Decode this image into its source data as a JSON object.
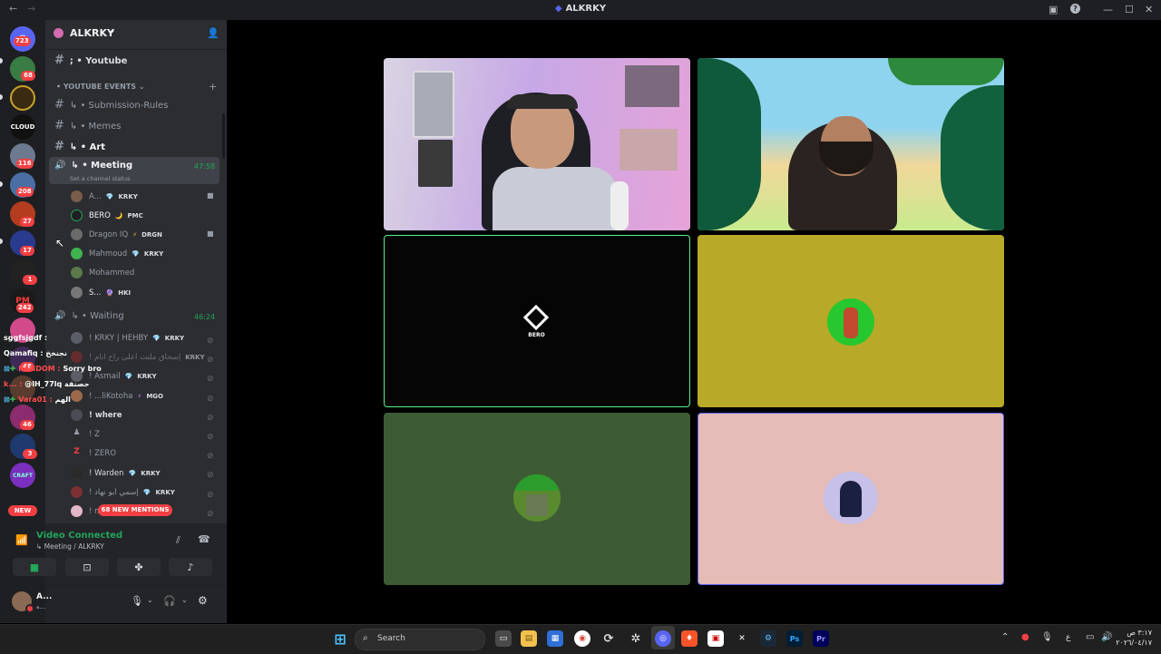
{
  "window": {
    "title": "ALKRKY"
  },
  "server": {
    "name": "ALKRKY"
  },
  "rail_badges": [
    "723",
    "68",
    "116",
    "208",
    "27",
    "17",
    "1",
    "242",
    "48",
    "46",
    "3"
  ],
  "rail_new_label": "NEW",
  "channels": {
    "youtube": "; • Youtube",
    "category": "• YOUTUBE EVENTS",
    "submission": "↳ • Submission-Rules",
    "memes": "↳ • Memes",
    "art": "↳ • Art",
    "meeting": "↳ • Meeting",
    "meeting_time": "47:58",
    "meeting_status": "Set a channel status",
    "waiting": "↳ • Waiting",
    "waiting_time": "46:24"
  },
  "meeting_members": [
    {
      "name": "A...",
      "tag": "KRKY"
    },
    {
      "name": "BERO",
      "tag": "PMC"
    },
    {
      "name": "Dragon IQ",
      "tag": "DRGN"
    },
    {
      "name": "Mahmoud",
      "tag": "KRKY"
    },
    {
      "name": "Mohammed",
      "tag": ""
    },
    {
      "name": "S...",
      "tag": "HKI"
    }
  ],
  "waiting_members": [
    {
      "name": "! KRKY | HEHBY",
      "tag": "KRKY"
    },
    {
      "name": "! إسحاق ملتت اعلى راح انام",
      "tag": "KRKY"
    },
    {
      "name": "! Asmail",
      "tag": "KRKY"
    },
    {
      "name": "! ...liKotoha",
      "tag": "MGO"
    },
    {
      "name": "! where",
      "tag": ""
    },
    {
      "name": "! Z",
      "tag": ""
    },
    {
      "name": "! ZERO",
      "tag": ""
    },
    {
      "name": "! Warden",
      "tag": "KRKY"
    },
    {
      "name": "! إسمي ابو نهاد",
      "tag": "KRKY"
    },
    {
      "name": "! m",
      "tag": ""
    }
  ],
  "mentions_label": "68 NEW MENTIONS",
  "chat_overlay": [
    {
      "user": "sggfsjgdf :",
      "msg": "",
      "color": "#ffffff"
    },
    {
      "user": "Qamafiq :",
      "msg": "نجنخخ",
      "color": "#ffffff"
    },
    {
      "user": "RANDOM :",
      "msg": "Sorry bro",
      "color": "#ff4d4d"
    },
    {
      "user": "k... :",
      "msg": "@lH_77lq حصنقة",
      "color": "#ff4d4d"
    },
    {
      "user": "Vara01 :",
      "msg": "الهم",
      "color": "#ff4d4d"
    }
  ],
  "voice": {
    "status": "Video Connected",
    "location": "↳ Meeting / ALKRKY"
  },
  "user": {
    "name": "A...",
    "sub": "ه..."
  },
  "tiles": {
    "bero_label": "BERO"
  },
  "taskbar": {
    "search_placeholder": "Search",
    "clock_time": "٣:١٧ ص",
    "clock_date": "٢٠٢٦/٠٤/١٧",
    "lang": "ع"
  },
  "colors": {
    "accent_green": "#23a55a",
    "tile_yellow": "#b9a928",
    "tile_green": "#3d5c35",
    "tile_pink": "#e5bcb8",
    "speaking_border": "#57f287",
    "selected_border": "#5865f2"
  }
}
